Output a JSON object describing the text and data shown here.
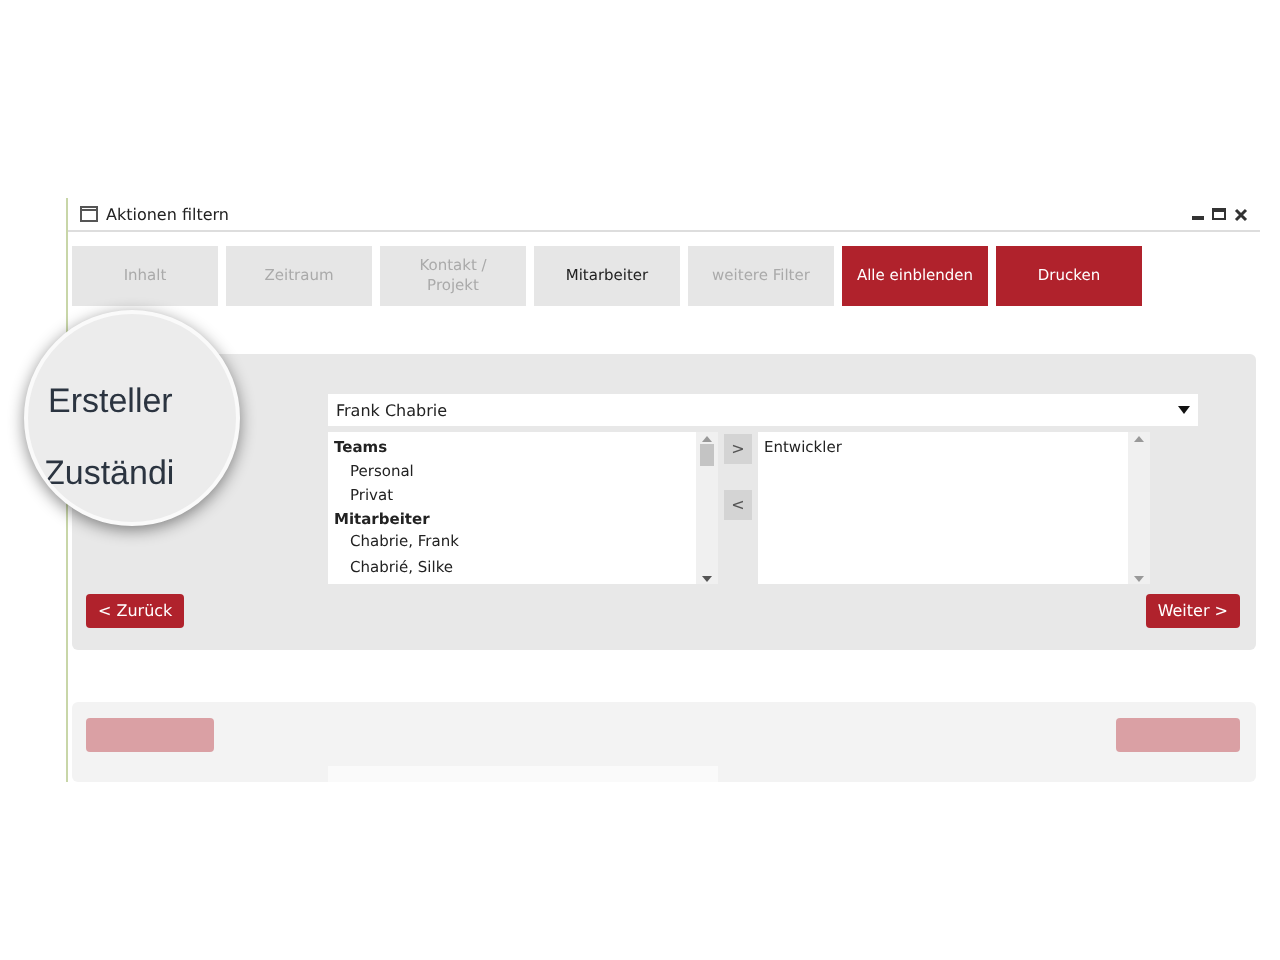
{
  "window": {
    "title": "Aktionen filtern"
  },
  "tabs": [
    {
      "label": "Inhalt",
      "selected": false
    },
    {
      "label": "Zeitraum",
      "selected": false
    },
    {
      "label": "Kontakt / Projekt",
      "selected": false
    },
    {
      "label": "Mitarbeiter",
      "selected": true
    },
    {
      "label": "weitere Filter",
      "selected": false
    }
  ],
  "actions": [
    "Alle einblenden",
    "Drucken"
  ],
  "magnifier": {
    "labels": [
      "Ersteller",
      "Zuständi"
    ]
  },
  "dropdown": {
    "value": "Frank Chabrie"
  },
  "available_list": {
    "groups": [
      {
        "title": "Teams",
        "items": [
          "Personal",
          "Privat"
        ]
      },
      {
        "title": "Mitarbeiter",
        "items": [
          "Chabrie, Frank",
          "Chabrié, Silke"
        ]
      }
    ]
  },
  "move_buttons": [
    ">",
    "<"
  ],
  "selected_list": {
    "items": [
      "Entwickler"
    ]
  },
  "back_button": "< Zurück",
  "next_button": "Weiter >"
}
